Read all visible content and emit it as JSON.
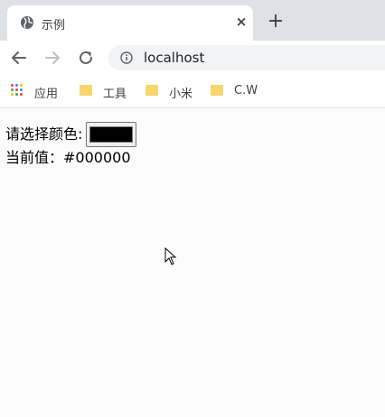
{
  "tab": {
    "title": "示例",
    "close": "×",
    "new_tab": "+"
  },
  "toolbar": {
    "url": "localhost"
  },
  "bookmarks": [
    {
      "label": "应用",
      "icon": "apps-grid-icon"
    },
    {
      "label": "工具",
      "icon": "folder-icon"
    },
    {
      "label": "小米",
      "icon": "folder-icon"
    },
    {
      "label": "C.W",
      "icon": "folder-icon"
    }
  ],
  "page": {
    "prompt_label": "请选择颜色:",
    "current_label": "当前值：",
    "current_value": "#000000",
    "picker_color": "#000000"
  }
}
